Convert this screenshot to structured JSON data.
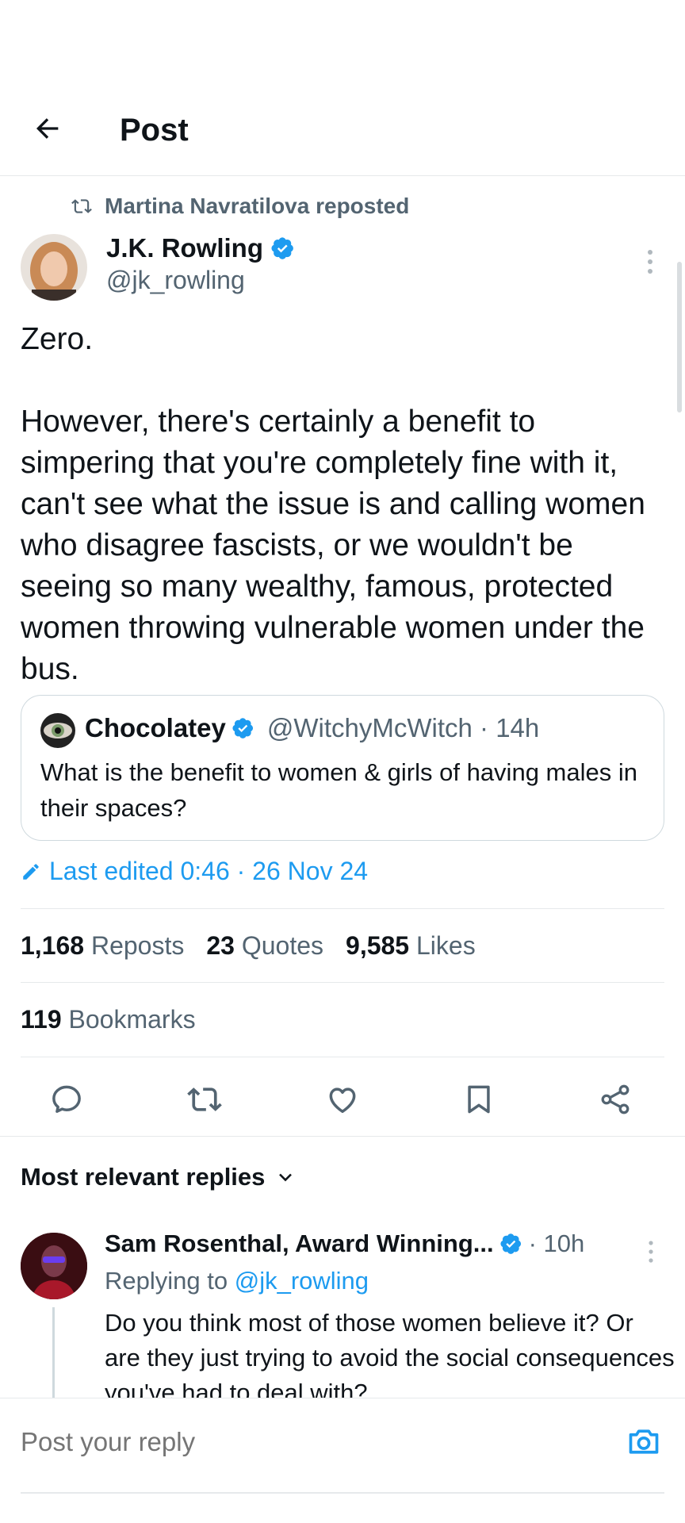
{
  "header": {
    "title": "Post"
  },
  "repost": {
    "text": "Martina Navratilova reposted"
  },
  "tweet": {
    "author_name": "J.K. Rowling",
    "author_handle": "@jk_rowling",
    "text": "Zero.\n\nHowever, there's certainly a benefit to simpering that you're completely fine with it, can't see what the issue is and calling women who disagree fascists, or we wouldn't be seeing so many wealthy, famous, protected women throwing vulnerable women under the bus.",
    "edited": "Last edited 0:46 · 26 Nov 24"
  },
  "quote": {
    "author_name": "Chocolatey",
    "author_handle": "@WitchyMcWitch · 14h",
    "text": "What is the benefit to women & girls of having males in their spaces?"
  },
  "stats": {
    "reposts_count": "1,168",
    "reposts_label": "Reposts",
    "quotes_count": "23",
    "quotes_label": "Quotes",
    "likes_count": "9,585",
    "likes_label": "Likes",
    "bookmarks_count": "119",
    "bookmarks_label": "Bookmarks"
  },
  "replies": {
    "sort_label": "Most relevant replies",
    "items": [
      {
        "author_name": "Sam Rosenthal, Award Winning...",
        "time": "· 10h",
        "replying_prefix": "Replying to",
        "replying_handle": "@jk_rowling",
        "text": "Do you think most of those women believe it? Or are they just trying to avoid the social consequences you've had to deal with?"
      }
    ]
  },
  "composer": {
    "placeholder": "Post your reply"
  },
  "colors": {
    "accent": "#1d9bf0",
    "secondary_text": "#536471",
    "divider": "#e6e9eb"
  },
  "icons": [
    "back-arrow-icon",
    "repost-icon",
    "verified-badge-icon",
    "more-icon",
    "pencil-icon",
    "reply-icon",
    "like-icon",
    "bookmark-icon",
    "share-icon",
    "chevron-down-icon",
    "camera-icon"
  ]
}
